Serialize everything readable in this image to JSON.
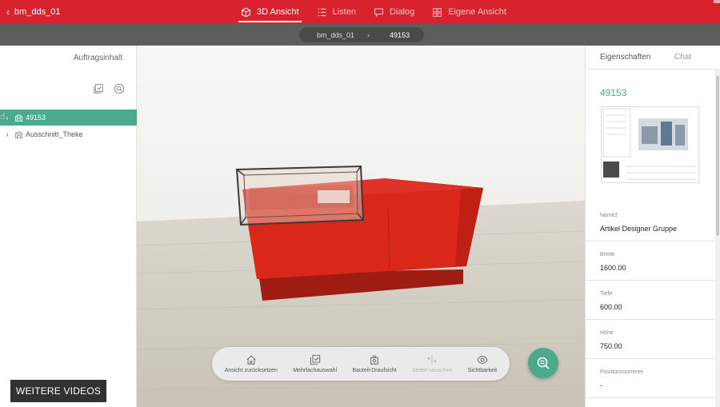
{
  "project": {
    "name": "bm_dds_01"
  },
  "tabs": [
    {
      "label": "3D Ansicht",
      "icon": "cube-icon",
      "active": true
    },
    {
      "label": "Listen",
      "icon": "list-icon",
      "active": false
    },
    {
      "label": "Dialog",
      "icon": "dialog-icon",
      "active": false
    },
    {
      "label": "Eigene Ansicht",
      "icon": "grid-icon",
      "active": false
    }
  ],
  "breadcrumb": {
    "root": "bm_dds_01",
    "separator": "›",
    "current": "49153"
  },
  "left_panel": {
    "title": "Auftragsinhalt",
    "tree": [
      {
        "label": "49153",
        "selected": true
      },
      {
        "label": "Ausschnitt_Theke",
        "selected": false
      }
    ]
  },
  "toolbar": {
    "items": [
      {
        "label": "Ansicht zurücksetzen",
        "icon": "home-icon",
        "enabled": true
      },
      {
        "label": "Mehrfachauswahl",
        "icon": "multi-select-icon",
        "enabled": true
      },
      {
        "label": "Bauteil-Draufsicht",
        "icon": "top-view-icon",
        "enabled": true
      },
      {
        "label": "Seiten tauschen",
        "icon": "swap-sides-icon",
        "enabled": false
      },
      {
        "label": "Sichtbarkeit",
        "icon": "eye-icon",
        "enabled": true
      }
    ]
  },
  "overlay": {
    "more_videos": "WEITERE VIDEOS"
  },
  "right_panel": {
    "tabs": [
      "Eigenschaften",
      "Chat"
    ],
    "title": "49153",
    "properties": [
      {
        "label": "Name2",
        "value": "Artikel Designer Gruppe"
      },
      {
        "label": "Breite",
        "value": "1600.00"
      },
      {
        "label": "Tiefe",
        "value": "600.00"
      },
      {
        "label": "Höhe",
        "value": "750.00"
      },
      {
        "label": "Positionsnummer",
        "value": "-"
      }
    ]
  },
  "colors": {
    "brand_red": "#d8232f",
    "accent_green": "#4da98b",
    "counter_red": "#d9271a"
  }
}
